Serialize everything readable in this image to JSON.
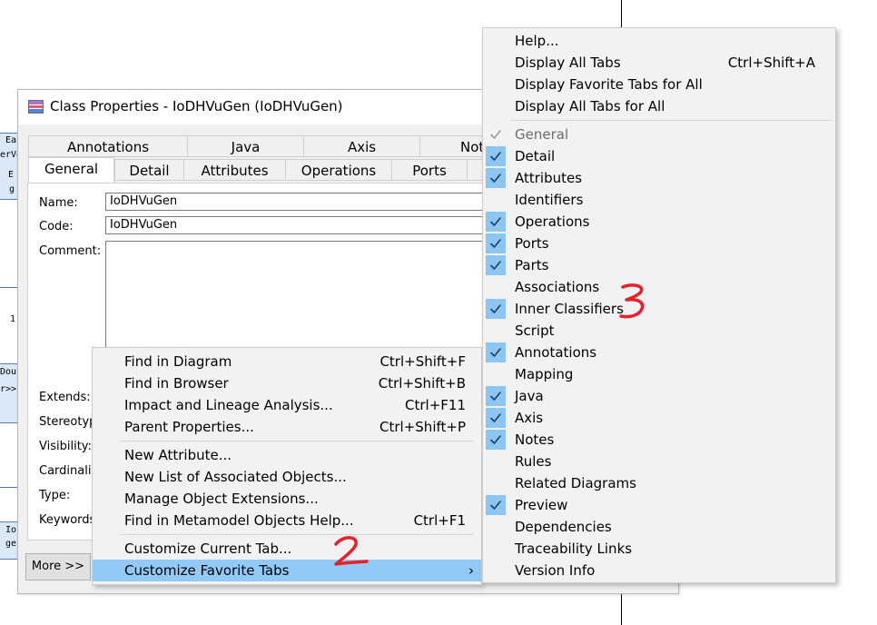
{
  "dialog": {
    "title": "Class Properties - IoDHVuGen (IoDHVuGen)",
    "tabs_row1": [
      "Annotations",
      "Java",
      "Axis",
      "Not"
    ],
    "tabs_row2": [
      "General",
      "Detail",
      "Attributes",
      "Operations",
      "Ports"
    ],
    "labels": {
      "name": "Name:",
      "code": "Code:",
      "comment": "Comment:",
      "extends": "Extends:",
      "stereotype": "Stereotyp",
      "visibility": "Visibility:",
      "cardinality": "Cardinalit",
      "type": "Type:",
      "keywords": "Keywords"
    },
    "name_value": "IoDHVuGen",
    "code_value": "IoDHVuGen",
    "more_button": "More >>"
  },
  "background": {
    "fragments": [
      "Ea",
      "erVe",
      "E",
      "g",
      "1",
      "Dou",
      "r>>",
      "Io",
      "ge"
    ]
  },
  "context_menu": {
    "group1": [
      {
        "label": "Find in Diagram",
        "shortcut": "Ctrl+Shift+F"
      },
      {
        "label": "Find in Browser",
        "shortcut": "Ctrl+Shift+B"
      },
      {
        "label": "Impact and Lineage Analysis...",
        "shortcut": "Ctrl+F11"
      },
      {
        "label": "Parent Properties...",
        "shortcut": "Ctrl+Shift+P"
      }
    ],
    "group2": [
      {
        "label": "New Attribute...",
        "shortcut": ""
      },
      {
        "label": "New List of Associated Objects...",
        "shortcut": ""
      },
      {
        "label": "Manage Object Extensions...",
        "shortcut": ""
      },
      {
        "label": "Find in Metamodel Objects Help...",
        "shortcut": "Ctrl+F1"
      }
    ],
    "group3": [
      {
        "label": "Customize Current Tab...",
        "shortcut": ""
      },
      {
        "label": "Customize Favorite Tabs",
        "shortcut": "",
        "submenu_arrow": "›",
        "highlighted": true
      }
    ]
  },
  "submenu": {
    "top": [
      {
        "label": "Help...",
        "shortcut": ""
      },
      {
        "label": "Display All Tabs",
        "shortcut": "Ctrl+Shift+A"
      },
      {
        "label": "Display Favorite Tabs for All",
        "shortcut": ""
      },
      {
        "label": "Display All Tabs for All",
        "shortcut": ""
      }
    ],
    "tabs": [
      {
        "label": "General",
        "checked": true,
        "disabled": true
      },
      {
        "label": "Detail",
        "checked": true
      },
      {
        "label": "Attributes",
        "checked": true
      },
      {
        "label": "Identifiers",
        "checked": false
      },
      {
        "label": "Operations",
        "checked": true
      },
      {
        "label": "Ports",
        "checked": true
      },
      {
        "label": "Parts",
        "checked": true
      },
      {
        "label": "Associations",
        "checked": false
      },
      {
        "label": "Inner Classifiers",
        "checked": true
      },
      {
        "label": "Script",
        "checked": false
      },
      {
        "label": "Annotations",
        "checked": true
      },
      {
        "label": "Mapping",
        "checked": false
      },
      {
        "label": "Java",
        "checked": true
      },
      {
        "label": "Axis",
        "checked": true
      },
      {
        "label": "Notes",
        "checked": true
      },
      {
        "label": "Rules",
        "checked": false
      },
      {
        "label": "Related Diagrams",
        "checked": false
      },
      {
        "label": "Preview",
        "checked": true
      },
      {
        "label": "Dependencies",
        "checked": false
      },
      {
        "label": "Traceability Links",
        "checked": false
      },
      {
        "label": "Version Info",
        "checked": false
      }
    ]
  },
  "annotations": {
    "mark_2": "2",
    "mark_3": "3",
    "color": "#e8202a"
  },
  "colors": {
    "highlight": "#91c9f7",
    "check_bg": "#8cc7f4",
    "menu_bg": "#f2f2f2"
  }
}
